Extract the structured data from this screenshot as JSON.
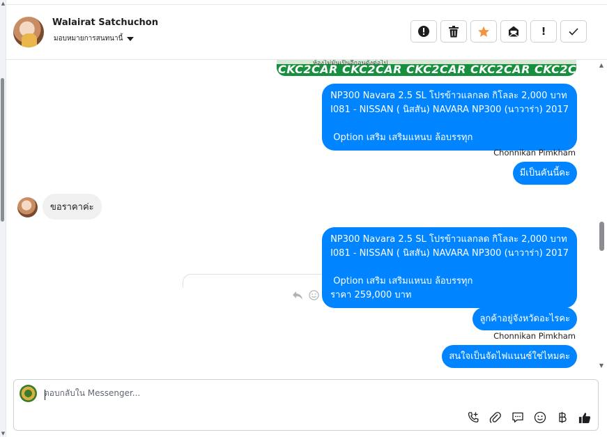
{
  "header": {
    "contact_name": "Walairat Satchuchon",
    "assign_label": "มอบหมายการสนทนานี้",
    "actions": [
      {
        "name": "report-icon"
      },
      {
        "name": "trash-icon"
      },
      {
        "name": "star-icon",
        "color": "#f5923e"
      },
      {
        "name": "mark-unread-icon"
      },
      {
        "name": "important-icon",
        "text": "!"
      },
      {
        "name": "done-icon"
      }
    ]
  },
  "conversation": {
    "image_strip_text": "CKC2CAR CKC2CAR CKC2CAR CKC2CAR CKC2CAR CKC",
    "image_strip_subtext": "ห้องไม่มันเป็นอีกอนดังต่อไป",
    "messages": [
      {
        "direction": "out",
        "text": "NP300 Navara 2.5 SL โปรข้าวแลกลด กิโลละ 2,000 บาท\nI081 - NISSAN ( นิสสัน) NAVARA NP300 (นาวาร่า) 2017\n\n Option เสริม เสริมแหนบ ล้อบรรทุก"
      },
      {
        "direction": "out",
        "sender": "Chonnikan Pimkham",
        "text": "มีเป็นคันนี้คะ"
      },
      {
        "direction": "in",
        "text": "ขอราคาค่ะ"
      },
      {
        "direction": "out",
        "text": "NP300 Navara 2.5 SL โปรข้าวแลกลด กิโลละ 2,000 บาท\nI081 - NISSAN ( นิสสัน) NAVARA NP300 (นาวาร่า) 2017\n\n Option เสริม เสริมแหนบ ล้อบรรทุก\nราคา 259,000 บาท"
      },
      {
        "direction": "out",
        "text": "ลูกค้าอยู่จังหวัดอะไรคะ"
      },
      {
        "direction": "out",
        "sender": "Chonnikan Pimkham",
        "text": "สนใจเป็นจัดไฟแนนซ์ใช่ไหมคะ"
      }
    ]
  },
  "composer": {
    "placeholder": "ตอบกลับใน Messenger...",
    "tools": [
      "call-plus-icon",
      "attach-icon",
      "saved-reply-icon",
      "emoji-icon",
      "baht-icon",
      "like-icon"
    ]
  }
}
